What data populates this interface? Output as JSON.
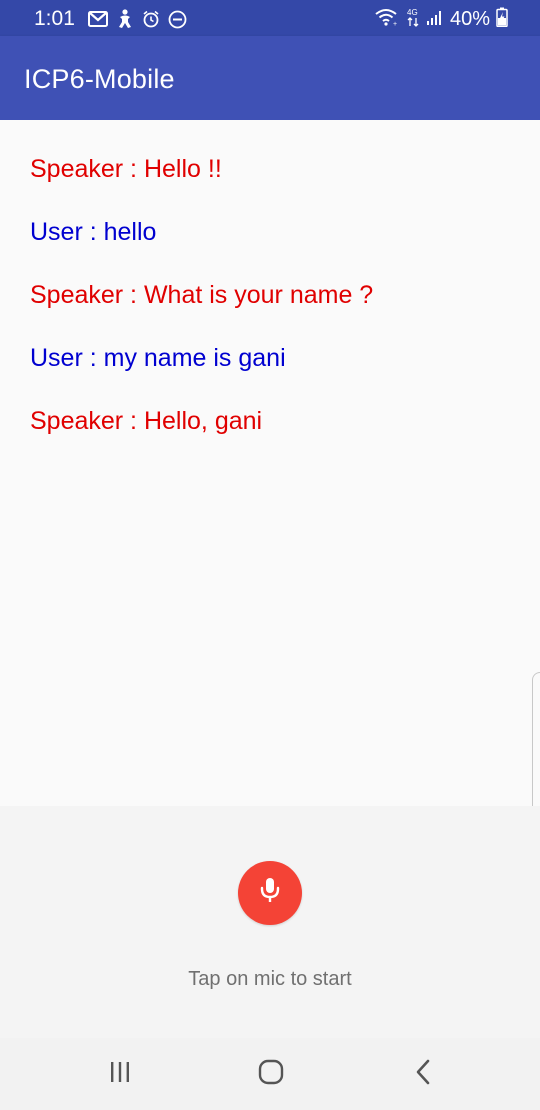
{
  "status_bar": {
    "time": "1:01",
    "battery_percent": "40%",
    "left_icons": [
      "gmail-icon",
      "accessibility-icon",
      "alarm-icon",
      "do-not-disturb-icon"
    ],
    "right_icons": [
      "wifi-icon",
      "data-transfer-icon",
      "signal-icon",
      "battery-charging-icon"
    ]
  },
  "app_bar": {
    "title": "ICP6-Mobile",
    "color": "#3f51b5"
  },
  "conversation": {
    "messages": [
      {
        "role": "speaker",
        "text": "Speaker : Hello !!"
      },
      {
        "role": "user",
        "text": "User : hello"
      },
      {
        "role": "speaker",
        "text": "Speaker : What is your name ?"
      },
      {
        "role": "user",
        "text": "User : my name is gani"
      },
      {
        "role": "speaker",
        "text": "Speaker : Hello, gani"
      }
    ],
    "speaker_color": "#e00000",
    "user_color": "#0000d0"
  },
  "mic_panel": {
    "icon": "microphone-icon",
    "button_color": "#f44336",
    "hint": "Tap on mic to start"
  },
  "nav_bar": {
    "icons": [
      "recents-icon",
      "home-icon",
      "back-icon"
    ]
  }
}
